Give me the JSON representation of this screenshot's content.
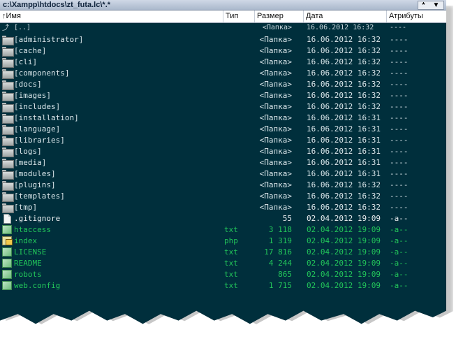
{
  "window": {
    "path": "c:\\Xampp\\htdocs\\zt_futa.lc\\*.*",
    "drive_menu_label": "*",
    "drive_menu_arrow": "▼"
  },
  "columns": {
    "name": "Имя",
    "ext": "Тип",
    "size": "Размер",
    "date": "Дата",
    "attr": "Атрибуты",
    "sort_arrow": "↑"
  },
  "rows": [
    {
      "kind": "updir",
      "name": "[..]",
      "ext": "",
      "size": "<Папка>",
      "date": "16.06.2012 16:32",
      "attr": "----",
      "icon": "up-dir-icon"
    },
    {
      "kind": "dir",
      "name": "[administrator]",
      "ext": "",
      "size": "<Папка>",
      "date": "16.06.2012 16:32",
      "attr": "----",
      "icon": "folder-icon"
    },
    {
      "kind": "dir",
      "name": "[cache]",
      "ext": "",
      "size": "<Папка>",
      "date": "16.06.2012 16:32",
      "attr": "----",
      "icon": "folder-icon"
    },
    {
      "kind": "dir",
      "name": "[cli]",
      "ext": "",
      "size": "<Папка>",
      "date": "16.06.2012 16:32",
      "attr": "----",
      "icon": "folder-icon"
    },
    {
      "kind": "dir",
      "name": "[components]",
      "ext": "",
      "size": "<Папка>",
      "date": "16.06.2012 16:32",
      "attr": "----",
      "icon": "folder-icon"
    },
    {
      "kind": "dir",
      "name": "[docs]",
      "ext": "",
      "size": "<Папка>",
      "date": "16.06.2012 16:32",
      "attr": "----",
      "icon": "folder-icon"
    },
    {
      "kind": "dir",
      "name": "[images]",
      "ext": "",
      "size": "<Папка>",
      "date": "16.06.2012 16:32",
      "attr": "----",
      "icon": "folder-icon"
    },
    {
      "kind": "dir",
      "name": "[includes]",
      "ext": "",
      "size": "<Папка>",
      "date": "16.06.2012 16:32",
      "attr": "----",
      "icon": "folder-icon"
    },
    {
      "kind": "dir",
      "name": "[installation]",
      "ext": "",
      "size": "<Папка>",
      "date": "16.06.2012 16:31",
      "attr": "----",
      "icon": "folder-icon"
    },
    {
      "kind": "dir",
      "name": "[language]",
      "ext": "",
      "size": "<Папка>",
      "date": "16.06.2012 16:31",
      "attr": "----",
      "icon": "folder-icon"
    },
    {
      "kind": "dir",
      "name": "[libraries]",
      "ext": "",
      "size": "<Папка>",
      "date": "16.06.2012 16:31",
      "attr": "----",
      "icon": "folder-icon"
    },
    {
      "kind": "dir",
      "name": "[logs]",
      "ext": "",
      "size": "<Папка>",
      "date": "16.06.2012 16:31",
      "attr": "----",
      "icon": "folder-icon"
    },
    {
      "kind": "dir",
      "name": "[media]",
      "ext": "",
      "size": "<Папка>",
      "date": "16.06.2012 16:31",
      "attr": "----",
      "icon": "folder-icon"
    },
    {
      "kind": "dir",
      "name": "[modules]",
      "ext": "",
      "size": "<Папка>",
      "date": "16.06.2012 16:31",
      "attr": "----",
      "icon": "folder-icon"
    },
    {
      "kind": "dir",
      "name": "[plugins]",
      "ext": "",
      "size": "<Папка>",
      "date": "16.06.2012 16:32",
      "attr": "----",
      "icon": "folder-icon"
    },
    {
      "kind": "dir",
      "name": "[templates]",
      "ext": "",
      "size": "<Папка>",
      "date": "16.06.2012 16:32",
      "attr": "----",
      "icon": "folder-icon"
    },
    {
      "kind": "dir",
      "name": "[tmp]",
      "ext": "",
      "size": "<Папка>",
      "date": "16.06.2012 16:32",
      "attr": "----",
      "icon": "folder-icon"
    },
    {
      "kind": "file-plain",
      "name": ".gitignore",
      "ext": "",
      "size": "55",
      "date": "02.04.2012 19:09",
      "attr": "-a--",
      "icon": "document-icon"
    },
    {
      "kind": "file-green",
      "name": "htaccess",
      "ext": "txt",
      "size": "3 118",
      "date": "02.04.2012 19:09",
      "attr": "-a--",
      "icon": "text-file-icon"
    },
    {
      "kind": "file-green",
      "name": "index",
      "ext": "php",
      "size": "1 319",
      "date": "02.04.2012 19:09",
      "attr": "-a--",
      "icon": "php-file-icon"
    },
    {
      "kind": "file-green",
      "name": "LICENSE",
      "ext": "txt",
      "size": "17 816",
      "date": "02.04.2012 19:09",
      "attr": "-a--",
      "icon": "text-file-icon"
    },
    {
      "kind": "file-green",
      "name": "README",
      "ext": "txt",
      "size": "4 244",
      "date": "02.04.2012 19:09",
      "attr": "-a--",
      "icon": "text-file-icon"
    },
    {
      "kind": "file-green",
      "name": "robots",
      "ext": "txt",
      "size": "865",
      "date": "02.04.2012 19:09",
      "attr": "-a--",
      "icon": "text-file-icon"
    },
    {
      "kind": "file-green",
      "name": "web.config",
      "ext": "txt",
      "size": "1 715",
      "date": "02.04.2012 19:09",
      "attr": "-a--",
      "icon": "text-file-icon"
    }
  ],
  "colors": {
    "panel_bg": "#002f3c",
    "dir_text": "#d9e6ea",
    "exec_text": "#22c65a"
  }
}
